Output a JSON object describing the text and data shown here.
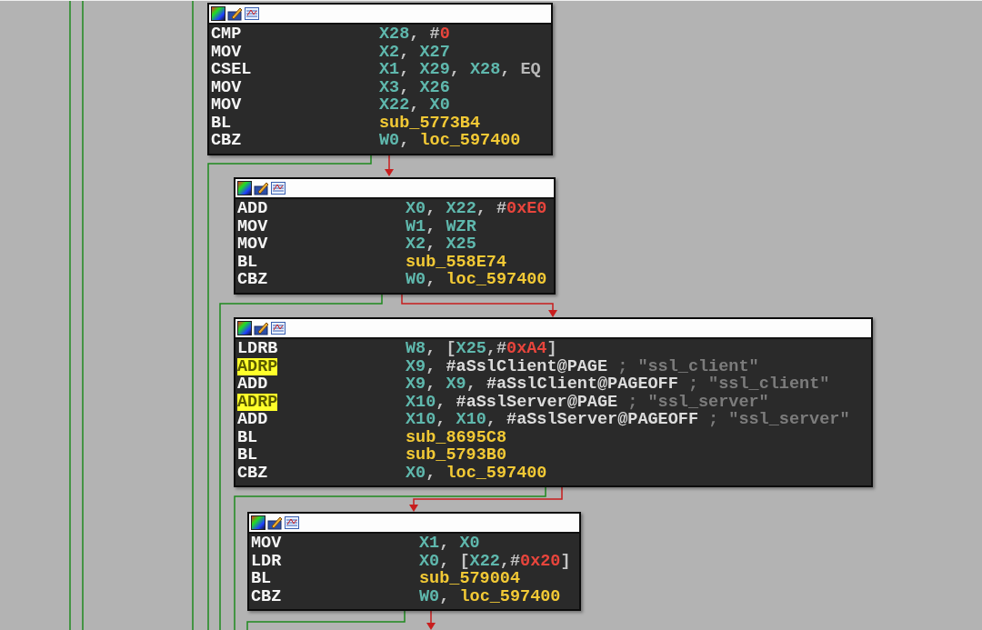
{
  "blocks": [
    {
      "lines": [
        {
          "mnemonic": "CMP",
          "highlighted": false,
          "operands": [
            {
              "kind": "reg",
              "text": "X28"
            },
            {
              "kind": "punct",
              "text": ", #"
            },
            {
              "kind": "imm",
              "text": "0"
            }
          ]
        },
        {
          "mnemonic": "MOV",
          "highlighted": false,
          "operands": [
            {
              "kind": "reg",
              "text": "X2"
            },
            {
              "kind": "punct",
              "text": ", "
            },
            {
              "kind": "reg",
              "text": "X27"
            }
          ]
        },
        {
          "mnemonic": "CSEL",
          "highlighted": false,
          "operands": [
            {
              "kind": "reg",
              "text": "X1"
            },
            {
              "kind": "punct",
              "text": ", "
            },
            {
              "kind": "reg",
              "text": "X29"
            },
            {
              "kind": "punct",
              "text": ", "
            },
            {
              "kind": "reg",
              "text": "X28"
            },
            {
              "kind": "punct",
              "text": ", "
            },
            {
              "kind": "cond",
              "text": "EQ"
            }
          ]
        },
        {
          "mnemonic": "MOV",
          "highlighted": false,
          "operands": [
            {
              "kind": "reg",
              "text": "X3"
            },
            {
              "kind": "punct",
              "text": ", "
            },
            {
              "kind": "reg",
              "text": "X26"
            }
          ]
        },
        {
          "mnemonic": "MOV",
          "highlighted": false,
          "operands": [
            {
              "kind": "reg",
              "text": "X22"
            },
            {
              "kind": "punct",
              "text": ", "
            },
            {
              "kind": "reg",
              "text": "X0"
            }
          ]
        },
        {
          "mnemonic": "BL",
          "highlighted": false,
          "operands": [
            {
              "kind": "name",
              "text": "sub_5773B4"
            }
          ]
        },
        {
          "mnemonic": "CBZ",
          "highlighted": false,
          "operands": [
            {
              "kind": "reg",
              "text": "W0"
            },
            {
              "kind": "punct",
              "text": ", "
            },
            {
              "kind": "name",
              "text": "loc_597400"
            }
          ]
        }
      ]
    },
    {
      "lines": [
        {
          "mnemonic": "ADD",
          "highlighted": false,
          "operands": [
            {
              "kind": "reg",
              "text": "X0"
            },
            {
              "kind": "punct",
              "text": ", "
            },
            {
              "kind": "reg",
              "text": "X22"
            },
            {
              "kind": "punct",
              "text": ", #"
            },
            {
              "kind": "imm",
              "text": "0xE0"
            }
          ]
        },
        {
          "mnemonic": "MOV",
          "highlighted": false,
          "operands": [
            {
              "kind": "reg",
              "text": "W1"
            },
            {
              "kind": "punct",
              "text": ", "
            },
            {
              "kind": "reg",
              "text": "WZR"
            }
          ]
        },
        {
          "mnemonic": "MOV",
          "highlighted": false,
          "operands": [
            {
              "kind": "reg",
              "text": "X2"
            },
            {
              "kind": "punct",
              "text": ", "
            },
            {
              "kind": "reg",
              "text": "X25"
            }
          ]
        },
        {
          "mnemonic": "BL",
          "highlighted": false,
          "operands": [
            {
              "kind": "name",
              "text": "sub_558E74"
            }
          ]
        },
        {
          "mnemonic": "CBZ",
          "highlighted": false,
          "operands": [
            {
              "kind": "reg",
              "text": "W0"
            },
            {
              "kind": "punct",
              "text": ", "
            },
            {
              "kind": "name",
              "text": "loc_597400"
            }
          ]
        }
      ]
    },
    {
      "lines": [
        {
          "mnemonic": "LDRB",
          "highlighted": false,
          "operands": [
            {
              "kind": "reg",
              "text": "W8"
            },
            {
              "kind": "punct",
              "text": ", ["
            },
            {
              "kind": "reg",
              "text": "X25"
            },
            {
              "kind": "punct",
              "text": ",#"
            },
            {
              "kind": "imm",
              "text": "0xA4"
            },
            {
              "kind": "punct",
              "text": "]"
            }
          ]
        },
        {
          "mnemonic": "ADRP",
          "highlighted": true,
          "operands": [
            {
              "kind": "reg",
              "text": "X9"
            },
            {
              "kind": "punct",
              "text": ", "
            },
            {
              "kind": "sym",
              "text": "#aSslClient@PAGE"
            },
            {
              "kind": "comment",
              "text": " ; \"ssl_client\""
            }
          ]
        },
        {
          "mnemonic": "ADD",
          "highlighted": false,
          "operands": [
            {
              "kind": "reg",
              "text": "X9"
            },
            {
              "kind": "punct",
              "text": ", "
            },
            {
              "kind": "reg",
              "text": "X9"
            },
            {
              "kind": "punct",
              "text": ", "
            },
            {
              "kind": "sym",
              "text": "#aSslClient@PAGEOFF"
            },
            {
              "kind": "comment",
              "text": " ; \"ssl_client\""
            }
          ]
        },
        {
          "mnemonic": "ADRP",
          "highlighted": true,
          "operands": [
            {
              "kind": "reg",
              "text": "X10"
            },
            {
              "kind": "punct",
              "text": ", "
            },
            {
              "kind": "sym",
              "text": "#aSslServer@PAGE"
            },
            {
              "kind": "comment",
              "text": " ; \"ssl_server\""
            }
          ]
        },
        {
          "mnemonic": "ADD",
          "highlighted": false,
          "operands": [
            {
              "kind": "reg",
              "text": "X10"
            },
            {
              "kind": "punct",
              "text": ", "
            },
            {
              "kind": "reg",
              "text": "X10"
            },
            {
              "kind": "punct",
              "text": ", "
            },
            {
              "kind": "sym",
              "text": "#aSslServer@PAGEOFF"
            },
            {
              "kind": "comment",
              "text": " ; \"ssl_server\""
            }
          ]
        },
        {
          "mnemonic": "BL",
          "highlighted": false,
          "operands": [
            {
              "kind": "name",
              "text": "sub_8695C8"
            }
          ]
        },
        {
          "mnemonic": "BL",
          "highlighted": false,
          "operands": [
            {
              "kind": "name",
              "text": "sub_5793B0"
            }
          ]
        },
        {
          "mnemonic": "CBZ",
          "highlighted": false,
          "operands": [
            {
              "kind": "reg",
              "text": "X0"
            },
            {
              "kind": "punct",
              "text": ", "
            },
            {
              "kind": "name",
              "text": "loc_597400"
            }
          ]
        }
      ]
    },
    {
      "lines": [
        {
          "mnemonic": "MOV",
          "highlighted": false,
          "operands": [
            {
              "kind": "reg",
              "text": "X1"
            },
            {
              "kind": "punct",
              "text": ", "
            },
            {
              "kind": "reg",
              "text": "X0"
            }
          ]
        },
        {
          "mnemonic": "LDR",
          "highlighted": false,
          "operands": [
            {
              "kind": "reg",
              "text": "X0"
            },
            {
              "kind": "punct",
              "text": ", ["
            },
            {
              "kind": "reg",
              "text": "X22"
            },
            {
              "kind": "punct",
              "text": ",#"
            },
            {
              "kind": "imm",
              "text": "0x20"
            },
            {
              "kind": "punct",
              "text": "]"
            }
          ]
        },
        {
          "mnemonic": "BL",
          "highlighted": false,
          "operands": [
            {
              "kind": "name",
              "text": "sub_579004"
            }
          ]
        },
        {
          "mnemonic": "CBZ",
          "highlighted": false,
          "operands": [
            {
              "kind": "reg",
              "text": "W0"
            },
            {
              "kind": "punct",
              "text": ", "
            },
            {
              "kind": "name",
              "text": "loc_597400"
            }
          ]
        }
      ]
    }
  ]
}
